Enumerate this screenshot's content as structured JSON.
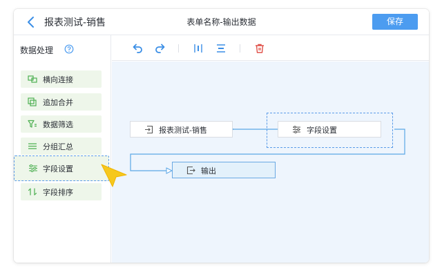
{
  "header": {
    "back_icon": "chevron-left-icon",
    "title": "报表测试-销售",
    "form_name": "表单名称-输出数据",
    "save_label": "保存"
  },
  "sidebar": {
    "title": "数据处理",
    "help_icon": "question-circle-icon",
    "items": [
      {
        "label": "横向连接",
        "icon": "link-join-icon"
      },
      {
        "label": "追加合并",
        "icon": "copy-merge-icon"
      },
      {
        "label": "数据筛选",
        "icon": "filter-icon"
      },
      {
        "label": "分组汇总",
        "icon": "list-group-icon"
      },
      {
        "label": "字段设置",
        "icon": "sliders-icon",
        "active": true
      },
      {
        "label": "字段排序",
        "icon": "sort-icon"
      }
    ]
  },
  "toolbar": {
    "buttons": [
      "undo-icon",
      "redo-icon",
      "align-vertical-icon",
      "align-horizontal-icon",
      "delete-icon"
    ]
  },
  "canvas": {
    "nodes": [
      {
        "label": "报表测试-销售",
        "icon": "import-icon"
      },
      {
        "label": "字段设置",
        "icon": "sliders-icon"
      },
      {
        "label": "输出",
        "icon": "export-icon"
      }
    ]
  },
  "colors": {
    "accent": "#4c9cf0",
    "item_bg": "#eef6ea",
    "canvas_bg": "#eef5fd",
    "connector": "#5aa6e6",
    "delete": "#e0524a"
  }
}
